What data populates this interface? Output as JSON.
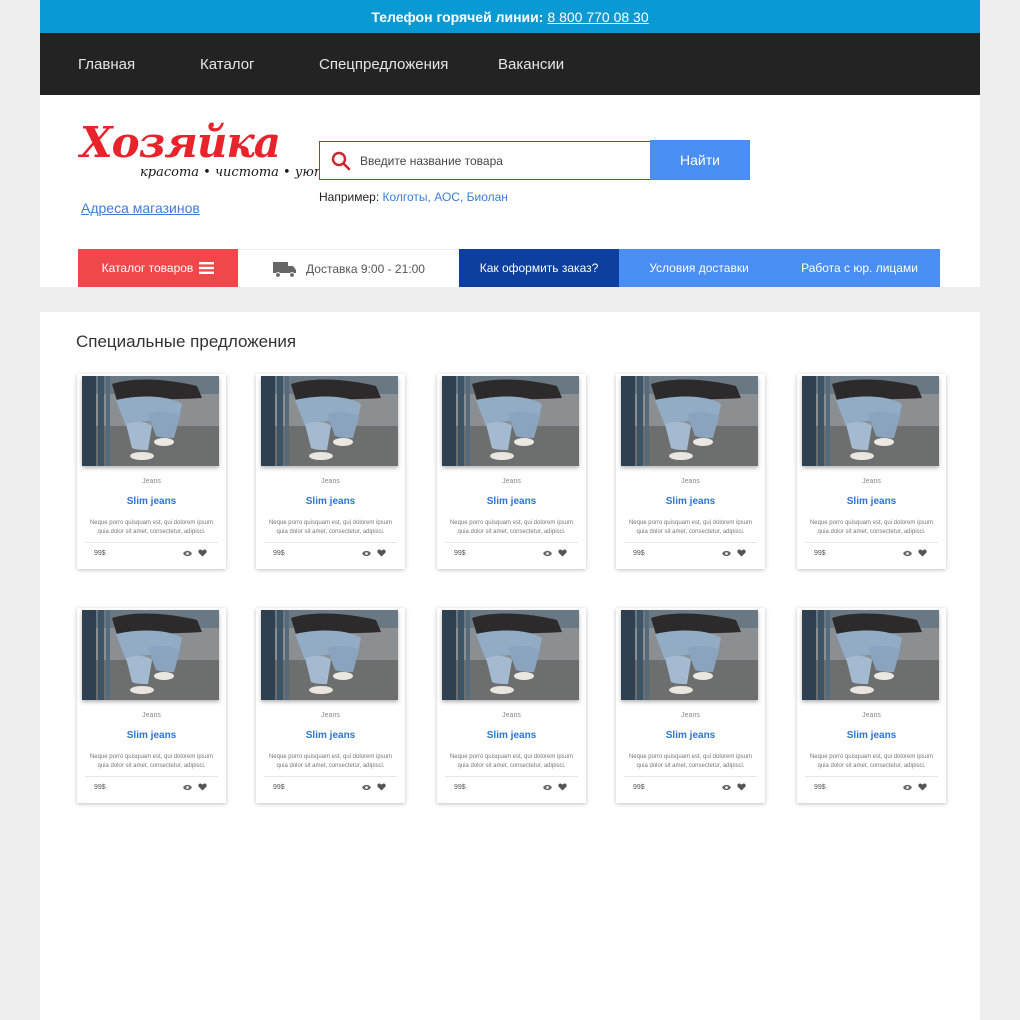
{
  "hotline": {
    "label": "Телефон горячей линии:",
    "phone": "8 800 770 08 30"
  },
  "nav": {
    "items": [
      "Главная",
      "Каталог",
      "Спецпредложения",
      "Вакансии"
    ]
  },
  "logo": {
    "name": "Хозяйка",
    "tagline": "красота • чистота • уют"
  },
  "stores_link": "Адреса магазинов",
  "search": {
    "placeholder": "Введите название товара",
    "button": "Найти",
    "examples_label": "Например:",
    "examples": "Колготы, АОС, Биолан"
  },
  "actions": {
    "catalog": "Каталог товаров",
    "delivery": "Доставка 9:00 - 21:00",
    "how_to_order": "Как оформить заказ?",
    "delivery_terms": "Условия доставки",
    "legal": "Работа с юр. лицами"
  },
  "special": {
    "title": "Специальные предложения",
    "products": [
      {
        "category": "Jeans",
        "name": "Slim jeans",
        "description": "Neque porro quisquam est, qui dolorem ipsum quia dolor sit amet, consectetur, adipisci.",
        "price": "99$"
      },
      {
        "category": "Jeans",
        "name": "Slim jeans",
        "description": "Neque porro quisquam est, qui dolorem ipsum quia dolor sit amet, consectetur, adipisci.",
        "price": "99$"
      },
      {
        "category": "Jeans",
        "name": "Slim jeans",
        "description": "Neque porro quisquam est, qui dolorem ipsum quia dolor sit amet, consectetur, adipisci.",
        "price": "99$"
      },
      {
        "category": "Jeans",
        "name": "Slim jeans",
        "description": "Neque porro quisquam est, qui dolorem ipsum quia dolor sit amet, consectetur, adipisci.",
        "price": "99$"
      },
      {
        "category": "Jeans",
        "name": "Slim jeans",
        "description": "Neque porro quisquam est, qui dolorem ipsum quia dolor sit amet, consectetur, adipisci.",
        "price": "99$"
      },
      {
        "category": "Jeans",
        "name": "Slim jeans",
        "description": "Neque porro quisquam est, qui dolorem ipsum quia dolor sit amet, consectetur, adipisci.",
        "price": "99$"
      },
      {
        "category": "Jeans",
        "name": "Slim jeans",
        "description": "Neque porro quisquam est, qui dolorem ipsum quia dolor sit amet, consectetur, adipisci.",
        "price": "99$"
      },
      {
        "category": "Jeans",
        "name": "Slim jeans",
        "description": "Neque porro quisquam est, qui dolorem ipsum quia dolor sit amet, consectetur, adipisci.",
        "price": "99$"
      },
      {
        "category": "Jeans",
        "name": "Slim jeans",
        "description": "Neque porro quisquam est, qui dolorem ipsum quia dolor sit amet, consectetur, adipisci.",
        "price": "99$"
      },
      {
        "category": "Jeans",
        "name": "Slim jeans",
        "description": "Neque porro quisquam est, qui dolorem ipsum quia dolor sit amet, consectetur, adipisci.",
        "price": "99$"
      }
    ]
  },
  "colors": {
    "hotline_bg": "#0a9ad3",
    "nav_bg": "#232323",
    "brand_red": "#e8232c",
    "catalog_red": "#f0474a",
    "dark_blue": "#0d3f9e",
    "accent_blue": "#4a8df3",
    "link_blue": "#3b7ed8"
  }
}
